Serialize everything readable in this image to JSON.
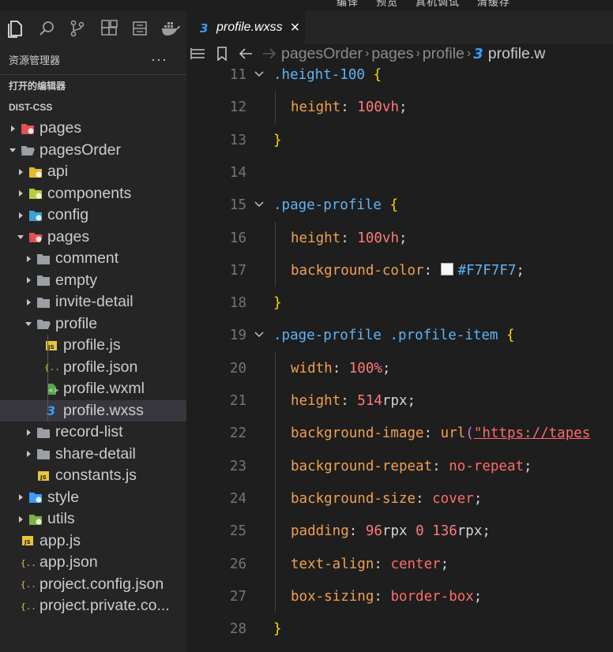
{
  "window": {
    "menu_items": [
      "编译",
      "预览",
      "真机调试",
      "清缓存"
    ]
  },
  "activity_bar": {
    "icons": [
      "files-icon",
      "search-icon",
      "source-control-icon",
      "extensions-icon",
      "outline-icon",
      "docker-icon"
    ]
  },
  "sidebar": {
    "title": "资源管理器",
    "more": "···",
    "open_editors": "打开的编辑器",
    "project": "DIST-CSS",
    "tree": [
      {
        "label": "pages",
        "depth": 0,
        "type": "folder",
        "expanded": false,
        "icon": "pages-folder-icon",
        "color": "#e05252"
      },
      {
        "label": "pagesOrder",
        "depth": 0,
        "type": "folder",
        "expanded": true,
        "icon": "folder-open-icon",
        "color": "#9aa0a6"
      },
      {
        "label": "api",
        "depth": 1,
        "type": "folder",
        "expanded": false,
        "icon": "api-folder-icon",
        "color": "#e8b92e"
      },
      {
        "label": "components",
        "depth": 1,
        "type": "folder",
        "expanded": false,
        "icon": "components-folder-icon",
        "color": "#b5cc3f"
      },
      {
        "label": "config",
        "depth": 1,
        "type": "folder",
        "expanded": false,
        "icon": "config-folder-icon",
        "color": "#3aa3d8"
      },
      {
        "label": "pages",
        "depth": 1,
        "type": "folder",
        "expanded": true,
        "icon": "pages-folder-icon",
        "color": "#e05252"
      },
      {
        "label": "comment",
        "depth": 2,
        "type": "folder",
        "expanded": false,
        "icon": "folder-icon",
        "color": "#9aa0a6"
      },
      {
        "label": "empty",
        "depth": 2,
        "type": "folder",
        "expanded": false,
        "icon": "folder-icon",
        "color": "#9aa0a6"
      },
      {
        "label": "invite-detail",
        "depth": 2,
        "type": "folder",
        "expanded": false,
        "icon": "folder-icon",
        "color": "#9aa0a6"
      },
      {
        "label": "profile",
        "depth": 2,
        "type": "folder",
        "expanded": true,
        "icon": "folder-open-icon",
        "color": "#9aa0a6"
      },
      {
        "label": "profile.js",
        "depth": 3,
        "type": "file",
        "icon": "js-file-icon",
        "color": "#e8c53a"
      },
      {
        "label": "profile.json",
        "depth": 3,
        "type": "file",
        "icon": "json-file-icon",
        "color": "#e8c53a"
      },
      {
        "label": "profile.wxml",
        "depth": 3,
        "type": "file",
        "icon": "wxml-file-icon",
        "color": "#57a64a"
      },
      {
        "label": "profile.wxss",
        "depth": 3,
        "type": "file",
        "icon": "css-file-icon",
        "color": "#3b9cff",
        "selected": true
      },
      {
        "label": "record-list",
        "depth": 2,
        "type": "folder",
        "expanded": false,
        "icon": "folder-icon",
        "color": "#9aa0a6"
      },
      {
        "label": "share-detail",
        "depth": 2,
        "type": "folder",
        "expanded": false,
        "icon": "folder-icon",
        "color": "#9aa0a6"
      },
      {
        "label": "constants.js",
        "depth": 2,
        "type": "file",
        "icon": "js-file-icon",
        "color": "#e8c53a"
      },
      {
        "label": "style",
        "depth": 1,
        "type": "folder",
        "expanded": false,
        "icon": "style-folder-icon",
        "color": "#3b9cff"
      },
      {
        "label": "utils",
        "depth": 1,
        "type": "folder",
        "expanded": false,
        "icon": "utils-folder-icon",
        "color": "#7cb342"
      },
      {
        "label": "app.js",
        "depth": 0,
        "type": "file",
        "icon": "js-file-icon",
        "color": "#e8c53a"
      },
      {
        "label": "app.json",
        "depth": 0,
        "type": "file",
        "icon": "json-file-icon",
        "color": "#e8c53a"
      },
      {
        "label": "project.config.json",
        "depth": 0,
        "type": "file",
        "icon": "json-file-icon",
        "color": "#e8c53a"
      },
      {
        "label": "project.private.co...",
        "depth": 0,
        "type": "file",
        "icon": "json-file-icon",
        "color": "#e8c53a"
      }
    ]
  },
  "editor": {
    "tab_label": "profile.wxss",
    "tab_close": "×",
    "breadcrumbs": [
      "pagesOrder",
      "pages",
      "profile",
      "profile.w"
    ],
    "lines": [
      {
        "n": "11",
        "fold": true,
        "tokens": [
          [
            ".height-100 ",
            "sel"
          ],
          [
            "{",
            "brace"
          ]
        ]
      },
      {
        "n": "12",
        "indent": true,
        "tokens": [
          [
            "height",
            "prop"
          ],
          [
            ": ",
            "punc"
          ],
          [
            "100",
            "num"
          ],
          [
            "vh",
            "unit"
          ],
          [
            ";",
            "punc"
          ]
        ]
      },
      {
        "n": "13",
        "tokens": [
          [
            "}",
            "brace"
          ]
        ]
      },
      {
        "n": "14",
        "tokens": []
      },
      {
        "n": "15",
        "fold": true,
        "tokens": [
          [
            ".page-profile ",
            "sel"
          ],
          [
            "{",
            "brace"
          ]
        ]
      },
      {
        "n": "16",
        "indent": true,
        "tokens": [
          [
            "height",
            "prop"
          ],
          [
            ": ",
            "punc"
          ],
          [
            "100",
            "num"
          ],
          [
            "vh",
            "unit"
          ],
          [
            ";",
            "punc"
          ]
        ]
      },
      {
        "n": "17",
        "indent": true,
        "swatch_line": true,
        "tokens": [
          [
            "background-color",
            "prop"
          ],
          [
            ": ",
            "punc"
          ],
          [
            "#F7F7F7",
            "hex"
          ],
          [
            ";",
            "punc"
          ]
        ]
      },
      {
        "n": "18",
        "tokens": [
          [
            "}",
            "brace"
          ]
        ]
      },
      {
        "n": "19",
        "fold": true,
        "tokens": [
          [
            ".page-profile .profile-item ",
            "sel"
          ],
          [
            "{",
            "brace"
          ]
        ]
      },
      {
        "n": "20",
        "indent": true,
        "tokens": [
          [
            "width",
            "prop"
          ],
          [
            ": ",
            "punc"
          ],
          [
            "100",
            "num"
          ],
          [
            "%",
            "unit"
          ],
          [
            ";",
            "punc"
          ]
        ]
      },
      {
        "n": "21",
        "indent": true,
        "tokens": [
          [
            "height",
            "prop"
          ],
          [
            ": ",
            "punc"
          ],
          [
            "514",
            "num"
          ],
          [
            "rpx",
            "plain"
          ],
          [
            ";",
            "punc"
          ]
        ]
      },
      {
        "n": "22",
        "indent": true,
        "tokens": [
          [
            "background-image",
            "prop"
          ],
          [
            ": ",
            "punc"
          ],
          [
            "url",
            "fn"
          ],
          [
            "(",
            "paren"
          ],
          [
            "\"https://tapes",
            "url"
          ]
        ]
      },
      {
        "n": "23",
        "indent": true,
        "tokens": [
          [
            "background-repeat",
            "prop"
          ],
          [
            ": ",
            "punc"
          ],
          [
            "no-repeat",
            "val"
          ],
          [
            ";",
            "punc"
          ]
        ]
      },
      {
        "n": "24",
        "indent": true,
        "tokens": [
          [
            "background-size",
            "prop"
          ],
          [
            ": ",
            "punc"
          ],
          [
            "cover",
            "val"
          ],
          [
            ";",
            "punc"
          ]
        ]
      },
      {
        "n": "25",
        "indent": true,
        "tokens": [
          [
            "padding",
            "prop"
          ],
          [
            ": ",
            "punc"
          ],
          [
            "96",
            "num"
          ],
          [
            "rpx ",
            "plain"
          ],
          [
            "0 ",
            "num"
          ],
          [
            "136",
            "num"
          ],
          [
            "rpx",
            "plain"
          ],
          [
            ";",
            "punc"
          ]
        ]
      },
      {
        "n": "26",
        "indent": true,
        "tokens": [
          [
            "text-align",
            "prop"
          ],
          [
            ": ",
            "punc"
          ],
          [
            "center",
            "val"
          ],
          [
            ";",
            "punc"
          ]
        ]
      },
      {
        "n": "27",
        "indent": true,
        "tokens": [
          [
            "box-sizing",
            "prop"
          ],
          [
            ": ",
            "punc"
          ],
          [
            "border-box",
            "val"
          ],
          [
            ";",
            "punc"
          ]
        ]
      },
      {
        "n": "28",
        "tokens": [
          [
            "}",
            "brace"
          ]
        ]
      }
    ]
  }
}
